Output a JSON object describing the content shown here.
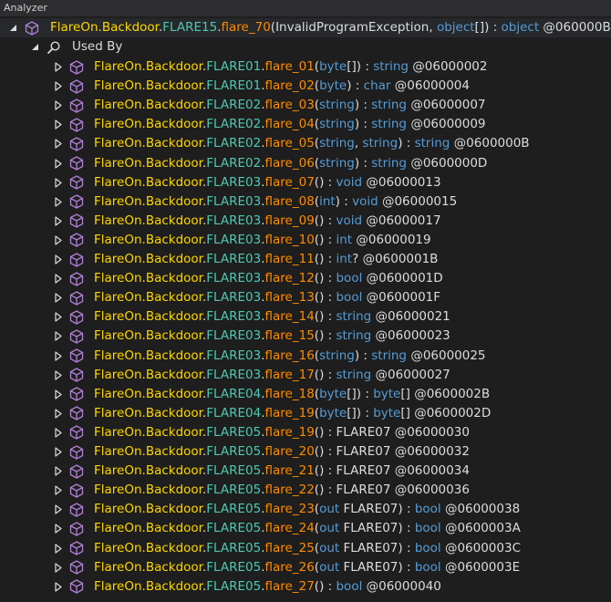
{
  "panel": {
    "title": "Analyzer"
  },
  "root": {
    "namespace": "FlareOn.Backdoor",
    "class": "FLARE15",
    "method": "flare_70",
    "params": [
      {
        "text": "InvalidProgramException",
        "kw": false
      },
      {
        "text": "object",
        "kw": true
      },
      {
        "text": "[]",
        "kw": false
      }
    ],
    "return_type": "object",
    "return_kw": true,
    "token": "@060000BB"
  },
  "used_by": {
    "label": "Used By"
  },
  "items": [
    {
      "ns": "FlareOn.Backdoor",
      "cls": "FLARE01",
      "m": "flare_01",
      "p": [
        [
          "byte",
          true
        ],
        [
          "[]",
          false
        ]
      ],
      "r": [
        [
          "string",
          true
        ]
      ],
      "tok": "@06000002"
    },
    {
      "ns": "FlareOn.Backdoor",
      "cls": "FLARE01",
      "m": "flare_02",
      "p": [
        [
          "byte",
          true
        ]
      ],
      "r": [
        [
          "char",
          true
        ]
      ],
      "tok": "@06000004"
    },
    {
      "ns": "FlareOn.Backdoor",
      "cls": "FLARE02",
      "m": "flare_03",
      "p": [
        [
          "string",
          true
        ]
      ],
      "r": [
        [
          "string",
          true
        ]
      ],
      "tok": "@06000007"
    },
    {
      "ns": "FlareOn.Backdoor",
      "cls": "FLARE02",
      "m": "flare_04",
      "p": [
        [
          "string",
          true
        ]
      ],
      "r": [
        [
          "string",
          true
        ]
      ],
      "tok": "@06000009"
    },
    {
      "ns": "FlareOn.Backdoor",
      "cls": "FLARE02",
      "m": "flare_05",
      "p": [
        [
          "string",
          true
        ],
        [
          ", ",
          false
        ],
        [
          "string",
          true
        ]
      ],
      "r": [
        [
          "string",
          true
        ]
      ],
      "tok": "@0600000B"
    },
    {
      "ns": "FlareOn.Backdoor",
      "cls": "FLARE02",
      "m": "flare_06",
      "p": [
        [
          "string",
          true
        ]
      ],
      "r": [
        [
          "string",
          true
        ]
      ],
      "tok": "@0600000D"
    },
    {
      "ns": "FlareOn.Backdoor",
      "cls": "FLARE03",
      "m": "flare_07",
      "p": [],
      "r": [
        [
          "void",
          true
        ]
      ],
      "tok": "@06000013"
    },
    {
      "ns": "FlareOn.Backdoor",
      "cls": "FLARE03",
      "m": "flare_08",
      "p": [
        [
          "int",
          true
        ]
      ],
      "r": [
        [
          "void",
          true
        ]
      ],
      "tok": "@06000015"
    },
    {
      "ns": "FlareOn.Backdoor",
      "cls": "FLARE03",
      "m": "flare_09",
      "p": [],
      "r": [
        [
          "void",
          true
        ]
      ],
      "tok": "@06000017"
    },
    {
      "ns": "FlareOn.Backdoor",
      "cls": "FLARE03",
      "m": "flare_10",
      "p": [],
      "r": [
        [
          "int",
          true
        ]
      ],
      "tok": "@06000019"
    },
    {
      "ns": "FlareOn.Backdoor",
      "cls": "FLARE03",
      "m": "flare_11",
      "p": [],
      "r": [
        [
          "int",
          true
        ],
        [
          "?",
          false
        ]
      ],
      "tok": "@0600001B"
    },
    {
      "ns": "FlareOn.Backdoor",
      "cls": "FLARE03",
      "m": "flare_12",
      "p": [],
      "r": [
        [
          "bool",
          true
        ]
      ],
      "tok": "@0600001D"
    },
    {
      "ns": "FlareOn.Backdoor",
      "cls": "FLARE03",
      "m": "flare_13",
      "p": [],
      "r": [
        [
          "bool",
          true
        ]
      ],
      "tok": "@0600001F"
    },
    {
      "ns": "FlareOn.Backdoor",
      "cls": "FLARE03",
      "m": "flare_14",
      "p": [],
      "r": [
        [
          "string",
          true
        ]
      ],
      "tok": "@06000021"
    },
    {
      "ns": "FlareOn.Backdoor",
      "cls": "FLARE03",
      "m": "flare_15",
      "p": [],
      "r": [
        [
          "string",
          true
        ]
      ],
      "tok": "@06000023"
    },
    {
      "ns": "FlareOn.Backdoor",
      "cls": "FLARE03",
      "m": "flare_16",
      "p": [
        [
          "string",
          true
        ]
      ],
      "r": [
        [
          "string",
          true
        ]
      ],
      "tok": "@06000025"
    },
    {
      "ns": "FlareOn.Backdoor",
      "cls": "FLARE03",
      "m": "flare_17",
      "p": [],
      "r": [
        [
          "string",
          true
        ]
      ],
      "tok": "@06000027"
    },
    {
      "ns": "FlareOn.Backdoor",
      "cls": "FLARE04",
      "m": "flare_18",
      "p": [
        [
          "byte",
          true
        ],
        [
          "[]",
          false
        ]
      ],
      "r": [
        [
          "byte",
          true
        ],
        [
          "[]",
          false
        ]
      ],
      "tok": "@0600002B"
    },
    {
      "ns": "FlareOn.Backdoor",
      "cls": "FLARE04",
      "m": "flare_19",
      "p": [
        [
          "byte",
          true
        ],
        [
          "[]",
          false
        ]
      ],
      "r": [
        [
          "byte",
          true
        ],
        [
          "[]",
          false
        ]
      ],
      "tok": "@0600002D"
    },
    {
      "ns": "FlareOn.Backdoor",
      "cls": "FLARE05",
      "m": "flare_19",
      "p": [],
      "r": [
        [
          "FLARE07",
          false
        ]
      ],
      "tok": "@06000030"
    },
    {
      "ns": "FlareOn.Backdoor",
      "cls": "FLARE05",
      "m": "flare_20",
      "p": [],
      "r": [
        [
          "FLARE07",
          false
        ]
      ],
      "tok": "@06000032"
    },
    {
      "ns": "FlareOn.Backdoor",
      "cls": "FLARE05",
      "m": "flare_21",
      "p": [],
      "r": [
        [
          "FLARE07",
          false
        ]
      ],
      "tok": "@06000034"
    },
    {
      "ns": "FlareOn.Backdoor",
      "cls": "FLARE05",
      "m": "flare_22",
      "p": [],
      "r": [
        [
          "FLARE07",
          false
        ]
      ],
      "tok": "@06000036"
    },
    {
      "ns": "FlareOn.Backdoor",
      "cls": "FLARE05",
      "m": "flare_23",
      "p": [
        [
          "out",
          true
        ],
        [
          " FLARE07",
          false
        ]
      ],
      "r": [
        [
          "bool",
          true
        ]
      ],
      "tok": "@06000038"
    },
    {
      "ns": "FlareOn.Backdoor",
      "cls": "FLARE05",
      "m": "flare_24",
      "p": [
        [
          "out",
          true
        ],
        [
          " FLARE07",
          false
        ]
      ],
      "r": [
        [
          "bool",
          true
        ]
      ],
      "tok": "@0600003A"
    },
    {
      "ns": "FlareOn.Backdoor",
      "cls": "FLARE05",
      "m": "flare_25",
      "p": [
        [
          "out",
          true
        ],
        [
          " FLARE07",
          false
        ]
      ],
      "r": [
        [
          "bool",
          true
        ]
      ],
      "tok": "@0600003C"
    },
    {
      "ns": "FlareOn.Backdoor",
      "cls": "FLARE05",
      "m": "flare_26",
      "p": [
        [
          "out",
          true
        ],
        [
          " FLARE07",
          false
        ]
      ],
      "r": [
        [
          "bool",
          true
        ]
      ],
      "tok": "@0600003E"
    },
    {
      "ns": "FlareOn.Backdoor",
      "cls": "FLARE05",
      "m": "flare_27",
      "p": [],
      "r": [
        [
          "bool",
          true
        ]
      ],
      "tok": "@06000040"
    }
  ],
  "colors": {
    "namespace": "#ffd700",
    "class": "#4ec9b0",
    "method": "#ff8c00",
    "keyword": "#569cd6",
    "method_icon": "#b180d7",
    "background": "#1e1e1e"
  },
  "icons": {
    "method": "method-cube-icon",
    "search": "magnifier-icon",
    "expand": "triangle-right-icon",
    "collapse": "triangle-down-icon"
  }
}
